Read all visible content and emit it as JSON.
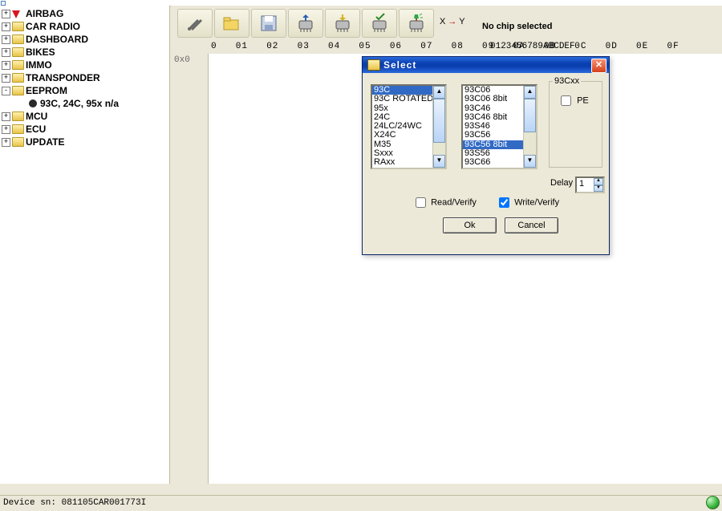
{
  "tree": [
    {
      "label": "AIRBAG",
      "icon": "pin",
      "expand": "+",
      "children": []
    },
    {
      "label": "CAR RADIO",
      "icon": "folder",
      "expand": "+",
      "children": []
    },
    {
      "label": "DASHBOARD",
      "icon": "folder",
      "expand": "+",
      "children": []
    },
    {
      "label": "BIKES",
      "icon": "folder",
      "expand": "+",
      "children": []
    },
    {
      "label": "IMMO",
      "icon": "folder",
      "expand": "+",
      "children": []
    },
    {
      "label": "TRANSPONDER",
      "icon": "folder",
      "expand": "+",
      "children": []
    },
    {
      "label": "EEPROM",
      "icon": "folder",
      "expand": "-",
      "children": [
        {
          "label": "93C, 24C, 95x n/a"
        }
      ]
    },
    {
      "label": "MCU",
      "icon": "folder",
      "expand": "+",
      "children": []
    },
    {
      "label": "ECU",
      "icon": "folder",
      "expand": "+",
      "children": []
    },
    {
      "label": "UPDATE",
      "icon": "folder",
      "expand": "+",
      "children": []
    }
  ],
  "toolbar": {
    "xy_left": "X",
    "xy_arrow": "→",
    "xy_right": "Y",
    "nochip": "No chip selected"
  },
  "hex": {
    "offsets": "0  01  02  03  04  05  06  07  08  09  0A  0B  0C  0D  0E  0F",
    "ascii": "0123456789ABCDEF",
    "row0": "0x0"
  },
  "dialog": {
    "title": "Select",
    "list1": {
      "items": [
        "93C",
        "93C ROTATED",
        "95x",
        "24C",
        "24LC/24WC",
        "X24C",
        "M35",
        "Sxxx",
        "RAxx"
      ],
      "selected": 0
    },
    "list2": {
      "items": [
        "93C06",
        "93C06 8bit",
        "93C46",
        "93C46 8bit",
        "93S46",
        "93C56",
        "93C56 8bit",
        "93S56",
        "93C66"
      ],
      "selected": 6
    },
    "group_label": "93Cxx",
    "pe_label": "PE",
    "pe_checked": false,
    "delay_label": "Delay",
    "delay_value": "1",
    "readverify_label": "Read/Verify",
    "readverify_checked": false,
    "writeverify_label": "Write/Verify",
    "writeverify_checked": true,
    "ok": "Ok",
    "cancel": "Cancel"
  },
  "status": "Device sn: 081105CAR001773I"
}
